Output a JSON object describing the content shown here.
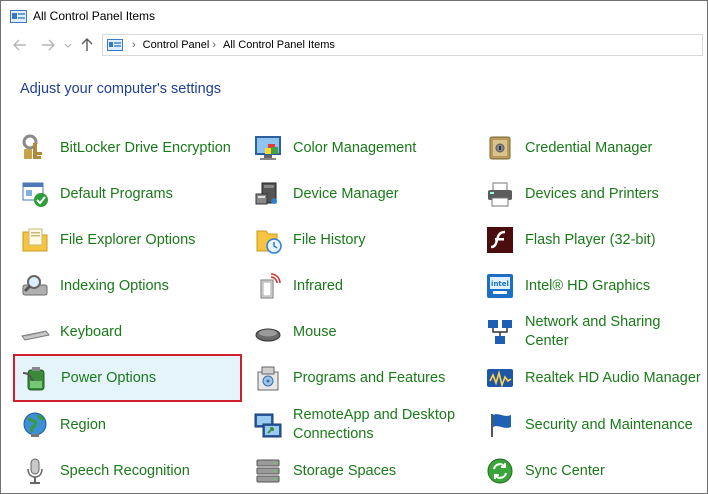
{
  "window": {
    "title": "All Control Panel Items"
  },
  "navigation": {
    "back_icon": "back-arrow-icon",
    "forward_icon": "forward-arrow-icon",
    "recent_icon": "chevron-down-icon",
    "up_icon": "up-arrow-icon",
    "breadcrumbs": [
      "Control Panel",
      "All Control Panel Items"
    ]
  },
  "page": {
    "heading": "Adjust your computer's settings"
  },
  "colors": {
    "link_green": "#1a7a1a",
    "heading_blue": "#1f3f95",
    "selection_border": "#d0202a",
    "selection_bg": "#e5f3fb"
  },
  "items": [
    {
      "label": "BitLocker Drive Encryption",
      "icon": "bitlocker-key-icon"
    },
    {
      "label": "Color Management",
      "icon": "color-management-icon"
    },
    {
      "label": "Credential Manager",
      "icon": "credential-vault-icon"
    },
    {
      "label": "Default Programs",
      "icon": "default-programs-icon"
    },
    {
      "label": "Device Manager",
      "icon": "device-manager-icon"
    },
    {
      "label": "Devices and Printers",
      "icon": "printer-icon"
    },
    {
      "label": "File Explorer Options",
      "icon": "folder-options-icon"
    },
    {
      "label": "File History",
      "icon": "file-history-icon"
    },
    {
      "label": "Flash Player (32-bit)",
      "icon": "flash-player-icon"
    },
    {
      "label": "Indexing Options",
      "icon": "indexing-search-icon"
    },
    {
      "label": "Infrared",
      "icon": "infrared-icon"
    },
    {
      "label": "Intel® HD Graphics",
      "icon": "intel-graphics-icon"
    },
    {
      "label": "Keyboard",
      "icon": "keyboard-icon"
    },
    {
      "label": "Mouse",
      "icon": "mouse-icon"
    },
    {
      "label": "Network and Sharing Center",
      "icon": "network-icon",
      "label_line1": "Network and Sharing",
      "label_line2": "Center"
    },
    {
      "label": "Power Options",
      "icon": "power-battery-icon",
      "selected": true
    },
    {
      "label": "Programs and Features",
      "icon": "programs-features-icon"
    },
    {
      "label": "Realtek HD Audio Manager",
      "icon": "realtek-audio-icon"
    },
    {
      "label": "Region",
      "icon": "region-globe-icon"
    },
    {
      "label": "RemoteApp and Desktop Connections",
      "icon": "remote-desktop-icon",
      "label_line1": "RemoteApp and Desktop",
      "label_line2": "Connections"
    },
    {
      "label": "Security and Maintenance",
      "icon": "security-flag-icon"
    },
    {
      "label": "Speech Recognition",
      "icon": "microphone-icon"
    },
    {
      "label": "Storage Spaces",
      "icon": "storage-spaces-icon"
    },
    {
      "label": "Sync Center",
      "icon": "sync-center-icon"
    }
  ]
}
